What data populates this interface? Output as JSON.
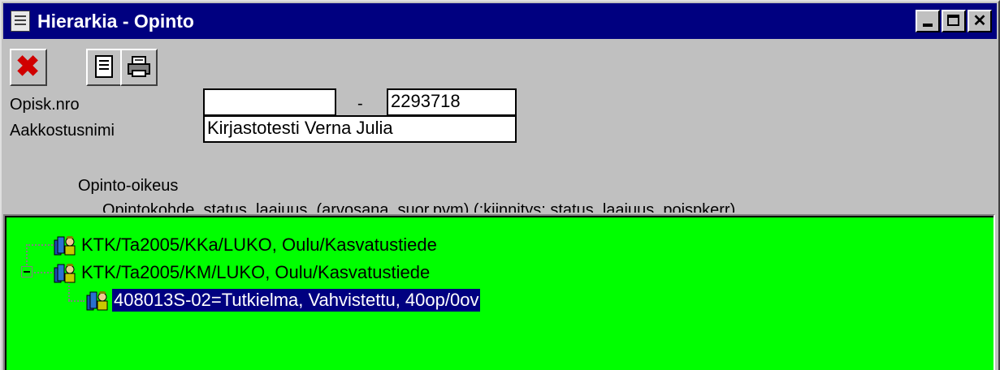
{
  "window": {
    "title": "Hierarkia - Opinto",
    "title_icon": "document-icon",
    "controls": [
      "minimize",
      "maximize",
      "close"
    ],
    "close_glyph": "✕"
  },
  "toolbar": {
    "close_glyph": "✖",
    "buttons": [
      {
        "icon": "close-icon",
        "color": "#d00000"
      },
      {
        "icon": "properties-icon"
      },
      {
        "icon": "printer-icon"
      }
    ]
  },
  "form": {
    "opisk_nro_label": "Opisk.nro",
    "opisk_nro_prefix": "",
    "dash": "-",
    "opisk_nro_value": "2293718",
    "aakkostusnimi_label": "Aakkostusnimi",
    "aakkostusnimi_value": "Kirjastotesti Verna Julia",
    "opinto_oikeus_label": "Opinto-oikeus",
    "clipped_header": "Opintokohde, status, laajuus, (arvosana, suor.pvm) (:kiinnitys; status, laajuus, poispkerr)"
  },
  "tree": {
    "background": "#00ff00",
    "selected_color": "#000080",
    "nodes": [
      {
        "label": "KTK/Ta2005/KKa/LUKO, Oulu/Kasvatustiede",
        "icon": "student-books-icon",
        "level": 0
      },
      {
        "label": "KTK/Ta2005/KM/LUKO, Oulu/Kasvatustiede",
        "icon": "student-books-icon",
        "level": 0,
        "expanded": true
      },
      {
        "label": "408013S-02=Tutkielma, Vahvistettu, 40op/0ov",
        "icon": "student-books-icon",
        "level": 1,
        "selected": true
      }
    ]
  }
}
